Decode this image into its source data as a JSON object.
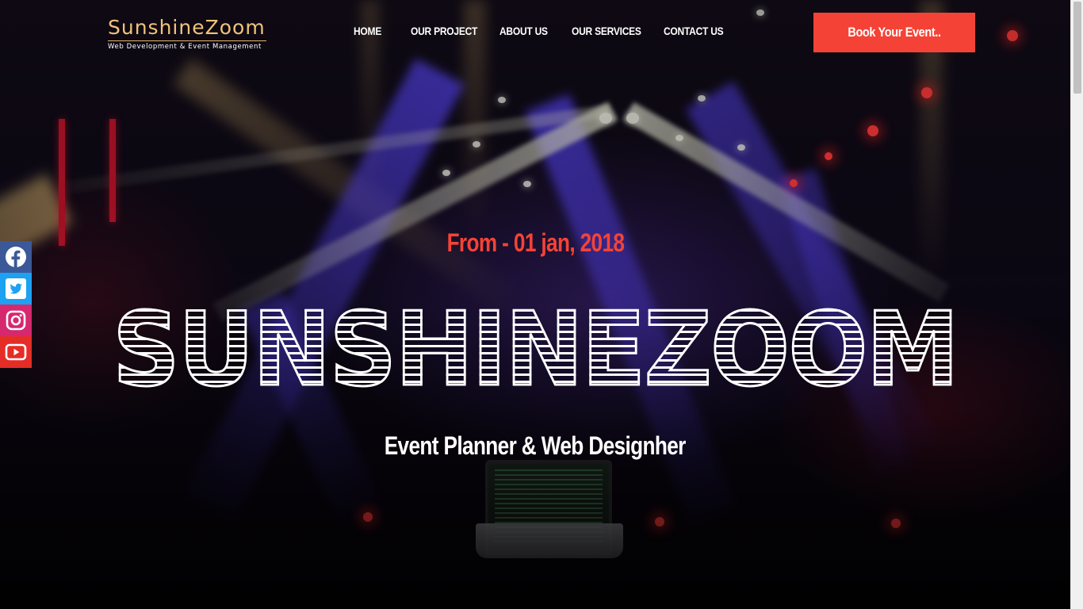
{
  "brand": {
    "name": "SunshineZoom",
    "tagline": "Web Development & Event Management"
  },
  "nav": {
    "items": [
      {
        "label": "HOME"
      },
      {
        "label": "OUR PROJECT"
      },
      {
        "label": "ABOUT US"
      },
      {
        "label": "OUR SERVICES"
      },
      {
        "label": "CONTACT US"
      }
    ],
    "cta_label": "Book Your Event.."
  },
  "hero": {
    "date_text": "From - 01 jan, 2018",
    "title": "SUNSHINEZOOM",
    "subtitle": "Event Planner & Web Designher"
  },
  "social": {
    "items": [
      {
        "icon": "facebook-icon",
        "color": "#3b5998"
      },
      {
        "icon": "twitter-icon",
        "color": "#1da1f2"
      },
      {
        "icon": "instagram-icon",
        "color": "#d6286f"
      },
      {
        "icon": "youtube-icon",
        "color": "#e52d27"
      }
    ]
  },
  "colors": {
    "accent": "#f44336",
    "logo": "#f1c27a"
  }
}
